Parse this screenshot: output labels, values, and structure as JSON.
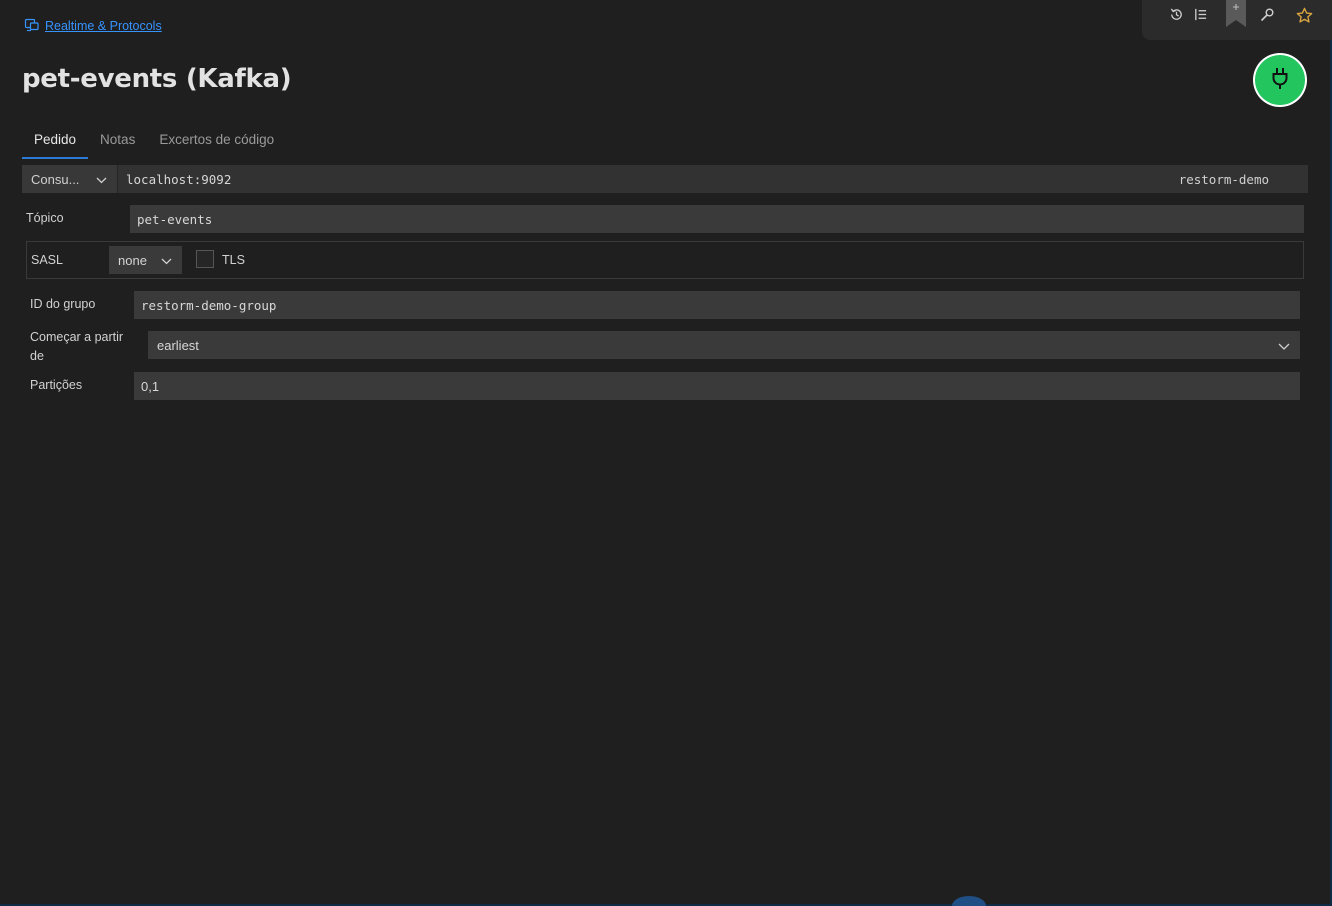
{
  "breadcrumb": {
    "collection_icon": "folder-network-icon",
    "label": "Realtime & Protocols"
  },
  "toolbar": {
    "icons": [
      "history-icon",
      "list-icon",
      "bookmark-icon",
      "wrench-icon",
      "star-icon"
    ],
    "star_color": "#d9a441"
  },
  "page": {
    "title": "pet-events (Kafka)"
  },
  "connect_button": {
    "icon": "plug-icon",
    "color": "#22c55e"
  },
  "tabs": [
    {
      "label": "Pedido",
      "active": true
    },
    {
      "label": "Notas",
      "active": false
    },
    {
      "label": "Excertos de código",
      "active": false
    }
  ],
  "request": {
    "mode": "Consu...",
    "broker_url": "localhost:9092",
    "environment": "restorm-demo"
  },
  "form": {
    "topic_label": "Tópico",
    "topic_value": "pet-events",
    "sasl_label": "SASL",
    "sasl_value": "none",
    "tls_label": "TLS",
    "tls_checked": false,
    "group_label": "ID do grupo",
    "group_value": "restorm-demo-group",
    "start_label_line1": "Começar a partir",
    "start_label_line2": "de",
    "start_value": "earliest",
    "partitions_label": "Partições",
    "partitions_value": "0,1"
  },
  "colors": {
    "accent": "#3794ff",
    "tab_underline": "#2b7bd6",
    "background": "#1f1f1f"
  }
}
